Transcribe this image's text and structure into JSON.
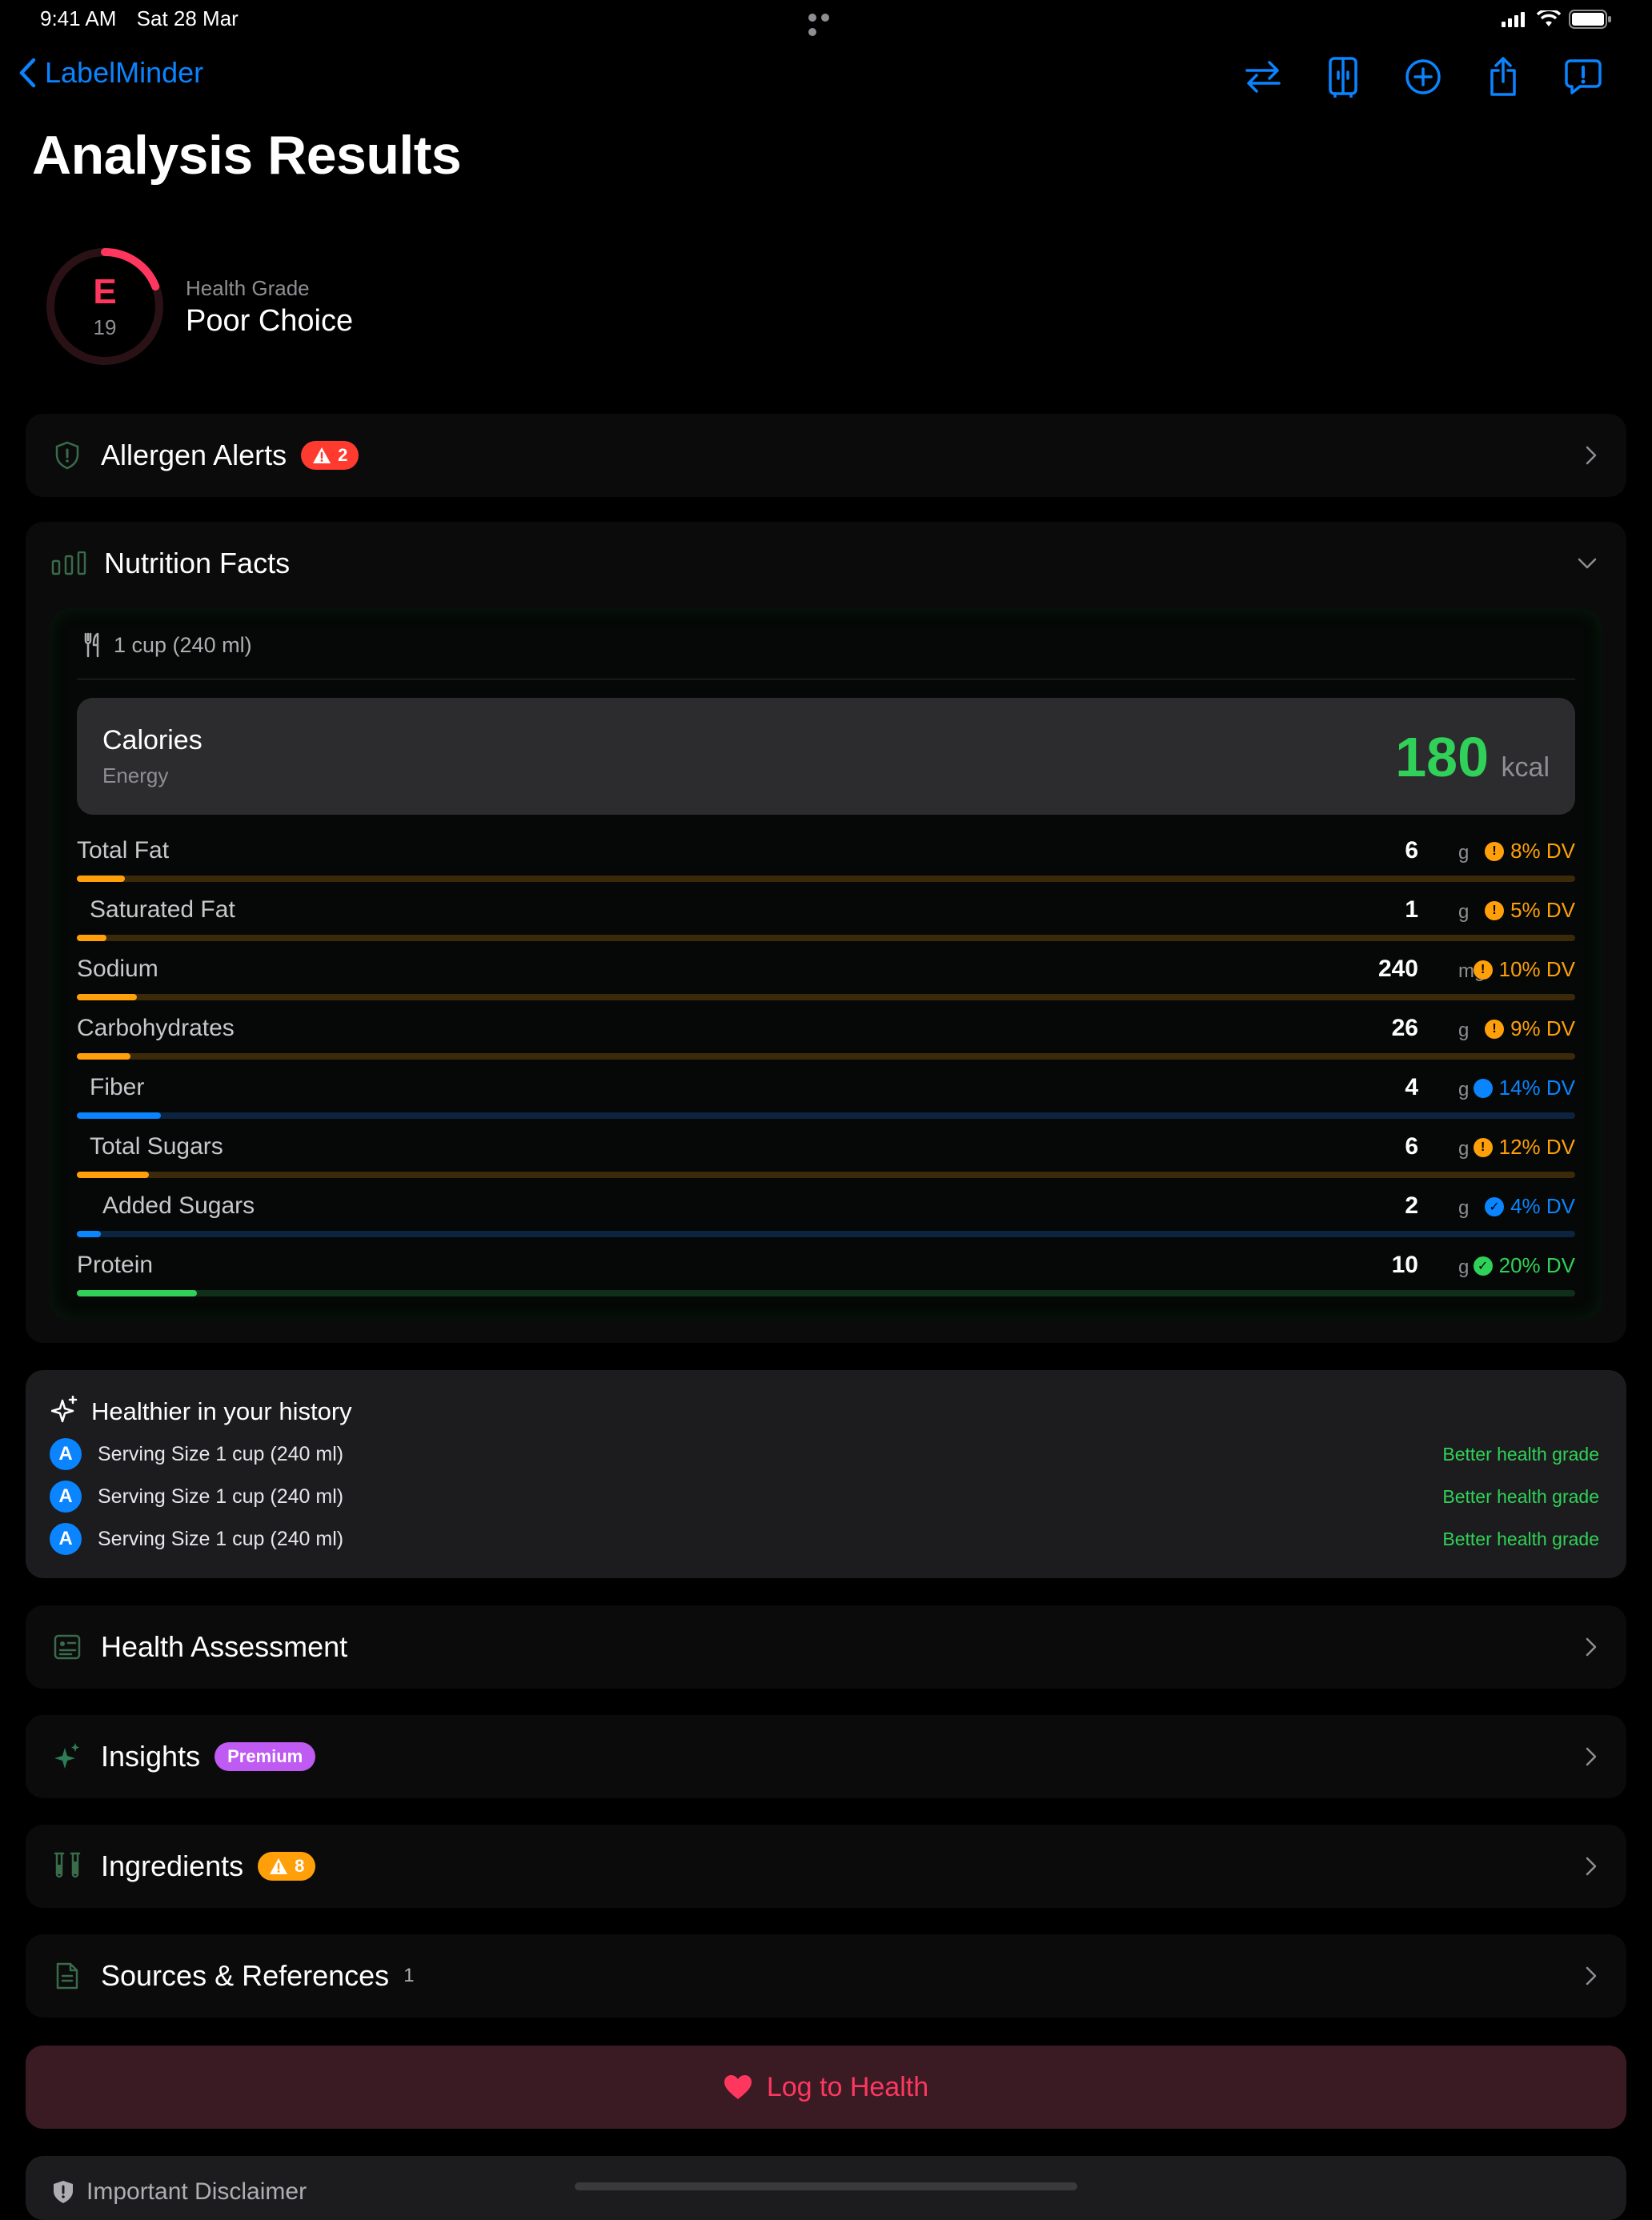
{
  "status": {
    "time": "9:41 AM",
    "date": "Sat 28 Mar"
  },
  "nav": {
    "back_label": "LabelMinder"
  },
  "page_title": "Analysis Results",
  "grade": {
    "label": "Health Grade",
    "letter": "E",
    "score": "19",
    "value": "Poor Choice",
    "score_fraction": 0.19,
    "color": "#ff375f"
  },
  "allergen": {
    "label": "Allergen Alerts",
    "count": "2"
  },
  "nutrition": {
    "label": "Nutrition Facts",
    "serving": "1 cup (240 ml)",
    "calories": {
      "title": "Calories",
      "subtitle": "Energy",
      "value": "180",
      "unit": "kcal"
    },
    "rows": [
      {
        "name": "Total Fat",
        "value": "6",
        "unit": "g",
        "dv": "8% DV",
        "percent": 8,
        "indent": 0,
        "status": "warn"
      },
      {
        "name": "Saturated Fat",
        "value": "1",
        "unit": "g",
        "dv": "5% DV",
        "percent": 5,
        "indent": 1,
        "status": "warn"
      },
      {
        "name": "Sodium",
        "value": "240",
        "unit": "mg",
        "dv": "10% DV",
        "percent": 10,
        "indent": 0,
        "status": "warn"
      },
      {
        "name": "Carbohydrates",
        "value": "26",
        "unit": "g",
        "dv": "9% DV",
        "percent": 9,
        "indent": 0,
        "status": "warn"
      },
      {
        "name": "Fiber",
        "value": "4",
        "unit": "g",
        "dv": "14% DV",
        "percent": 14,
        "indent": 1,
        "status": "info"
      },
      {
        "name": "Total Sugars",
        "value": "6",
        "unit": "g",
        "dv": "12% DV",
        "percent": 12,
        "indent": 1,
        "status": "warn"
      },
      {
        "name": "Added Sugars",
        "value": "2",
        "unit": "g",
        "dv": "4% DV",
        "percent": 4,
        "indent": 2,
        "status": "check-blue"
      },
      {
        "name": "Protein",
        "value": "10",
        "unit": "g",
        "dv": "20% DV",
        "percent": 20,
        "indent": 0,
        "status": "good"
      }
    ]
  },
  "history": {
    "title": "Healthier in your history",
    "items": [
      {
        "grade": "A",
        "text": "Serving Size 1 cup (240 ml)",
        "note": "Better health grade"
      },
      {
        "grade": "A",
        "text": "Serving Size 1 cup (240 ml)",
        "note": "Better health grade"
      },
      {
        "grade": "A",
        "text": "Serving Size 1 cup (240 ml)",
        "note": "Better health grade"
      }
    ]
  },
  "sections": {
    "health_assessment": "Health Assessment",
    "insights": "Insights",
    "insights_badge": "Premium",
    "ingredients": "Ingredients",
    "ingredients_count": "8",
    "sources": "Sources & References",
    "sources_count": "1"
  },
  "log_label": "Log to Health",
  "disclaimer_label": "Important Disclaimer",
  "colors": {
    "accent": "#0a84ff",
    "warn": "#ff9f0a",
    "good": "#30d158",
    "danger": "#ff375f",
    "premium": "#bf5af2"
  }
}
